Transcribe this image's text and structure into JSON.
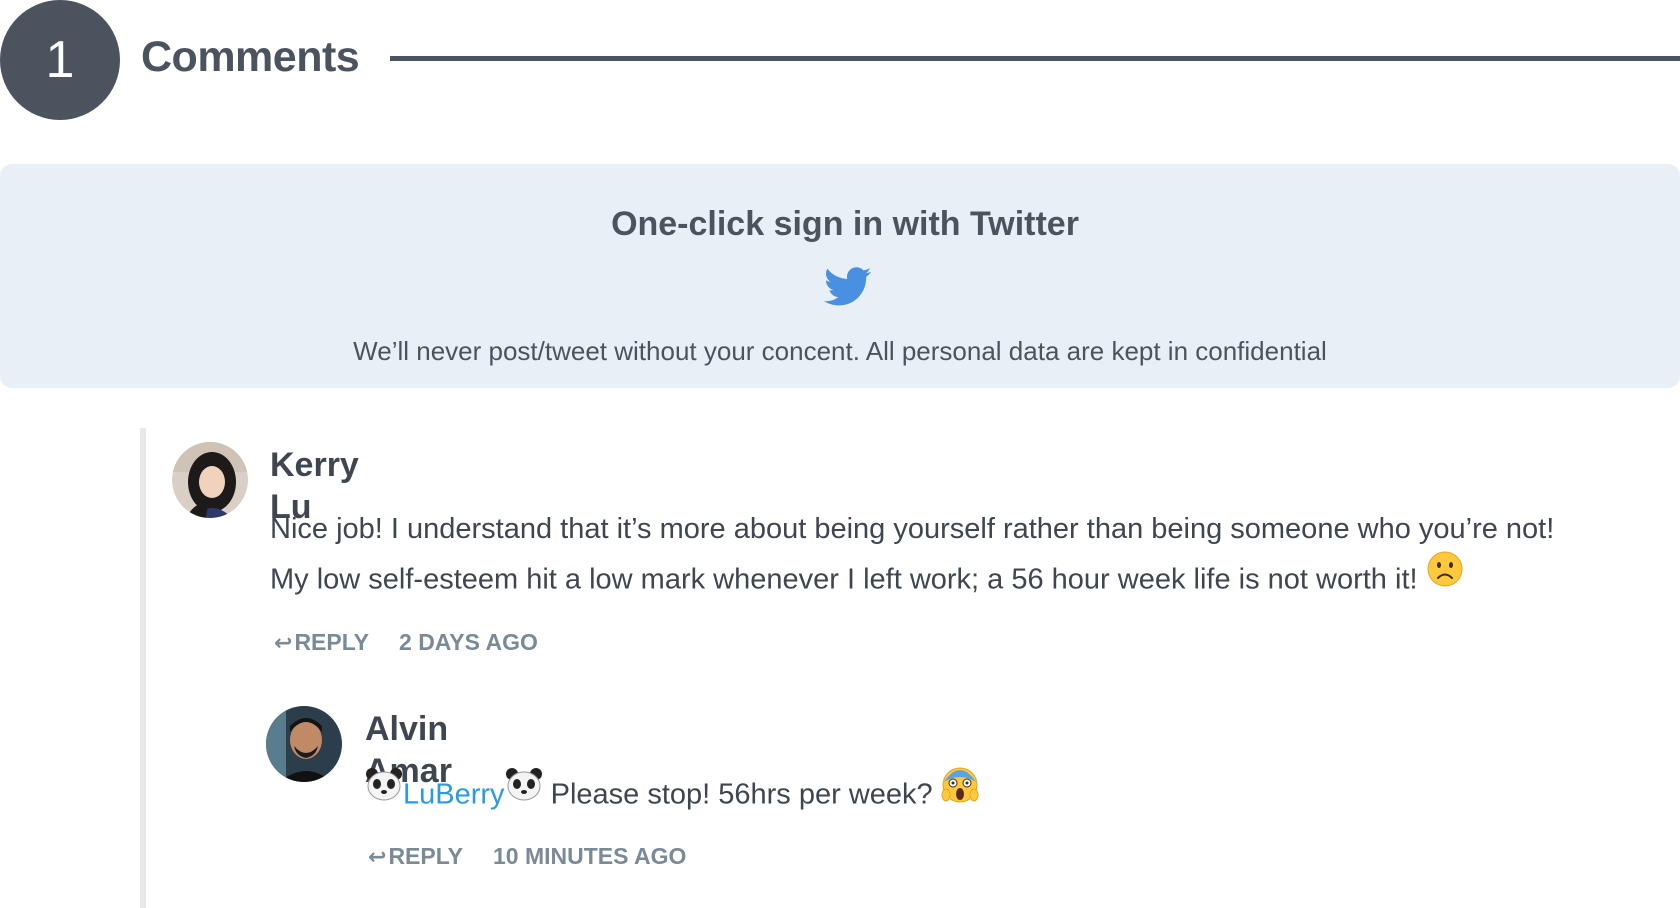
{
  "header": {
    "comment_count": "1",
    "title": "Comments"
  },
  "signin": {
    "title": "One-click sign in with Twitter",
    "icon": "twitter-bird-icon",
    "note": "We’ll never post/tweet without your concent. All personal data are kept in confidential",
    "accent_color": "#4a90e2"
  },
  "comments": [
    {
      "author": "Kerry Lu",
      "avatar": "kerry-lu-avatar",
      "lines": [
        "Nice job! I understand that it’s more about being yourself rather than being someone who you’re not!",
        "My low self-esteem hit a low mark whenever I left work; a 56 hour week life is not worth it!"
      ],
      "emoji": "slightly-frowning-face",
      "reply_label": "REPLY",
      "time": "2 DAYS AGO"
    },
    {
      "author": "Alvin Amar",
      "avatar": "alvin-amar-avatar",
      "mention": "LuBerry",
      "mention_emoji": "panda-face",
      "text": " Please stop! 56hrs per week? ",
      "emoji": "face-screaming-in-fear",
      "reply_label": "REPLY",
      "time": "10 MINUTES AGO"
    }
  ],
  "colors": {
    "badge": "#4b545e",
    "panel": "#e9eff6",
    "mention": "#2a9be0",
    "meta": "#7a8a96"
  }
}
